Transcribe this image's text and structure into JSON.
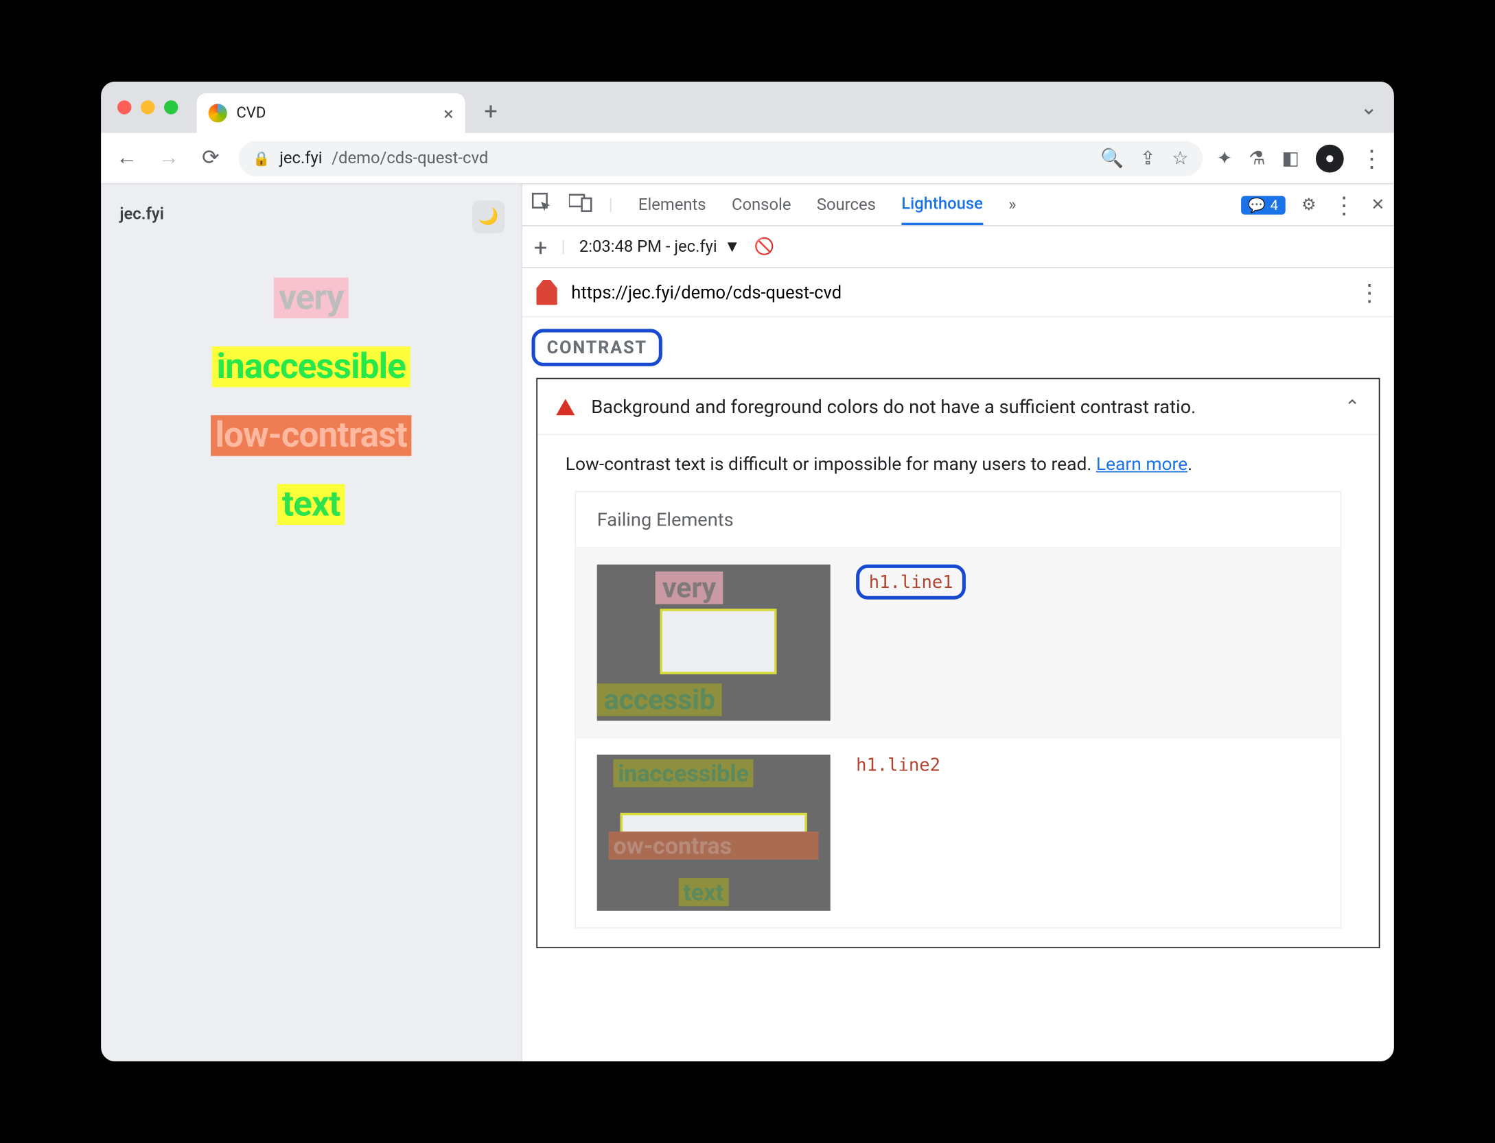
{
  "browser": {
    "tab_title": "CVD",
    "url_domain": "jec.fyi",
    "url_path": "/demo/cds-quest-cvd"
  },
  "page": {
    "site_name": "jec.fyi",
    "words": {
      "very": "very",
      "inaccessible": "inaccessible",
      "lowcontrast": "low-contrast",
      "text": "text"
    }
  },
  "devtools": {
    "tabs": {
      "elements": "Elements",
      "console": "Console",
      "sources": "Sources",
      "lighthouse": "Lighthouse"
    },
    "issues_badge": "4",
    "report_label": "2:03:48 PM - jec.fyi",
    "report_url": "https://jec.fyi/demo/cds-quest-cvd",
    "section": "CONTRAST",
    "audit": {
      "title": "Background and foreground colors do not have a sufficient contrast ratio.",
      "desc": "Low-contrast text is difficult or impossible for many users to read. ",
      "learn": "Learn more",
      "period": ".",
      "failing_header": "Failing Elements",
      "items": [
        {
          "selector": "h1.line1"
        },
        {
          "selector": "h1.line2"
        }
      ]
    }
  }
}
